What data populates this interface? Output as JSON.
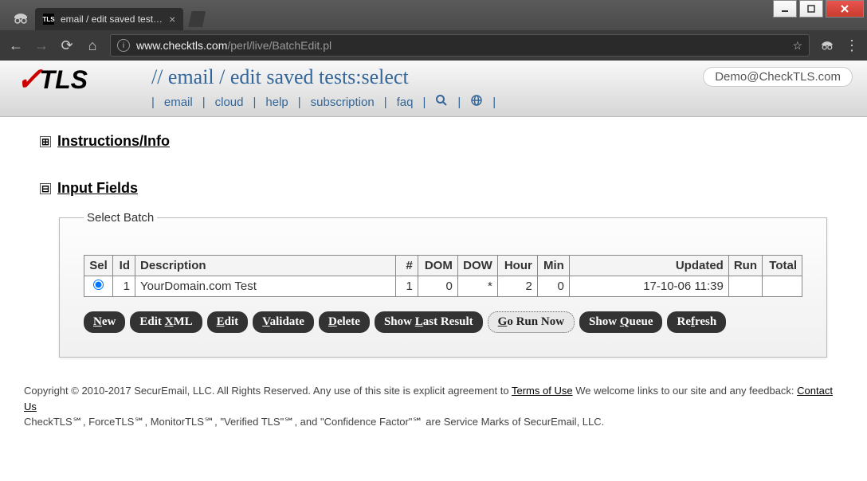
{
  "window": {
    "tab_title": "email / edit saved test…",
    "url_display": "www.checktls.com/perl/live/BatchEdit.pl",
    "url_host": "www.checktls.com",
    "url_path": "/perl/live/BatchEdit.pl"
  },
  "header": {
    "logo_text": "TLS",
    "page_title": "// email / edit saved tests:select",
    "user_email": "Demo@CheckTLS.com",
    "nav": [
      "email",
      "cloud",
      "help",
      "subscription",
      "faq"
    ]
  },
  "sections": {
    "instructions": {
      "label": "Instructions/Info",
      "expanded": false
    },
    "input_fields": {
      "label": "Input Fields",
      "expanded": true
    }
  },
  "fieldset_legend": "Select Batch",
  "table": {
    "headers": {
      "sel": "Sel",
      "id": "Id",
      "desc": "Description",
      "count": "#",
      "dom": "DOM",
      "dow": "DOW",
      "hour": "Hour",
      "min": "Min",
      "updated": "Updated",
      "run": "Run",
      "total": "Total"
    },
    "rows": [
      {
        "selected": true,
        "id": "1",
        "desc": "YourDomain.com Test",
        "count": "1",
        "dom": "0",
        "dow": "*",
        "hour": "2",
        "min": "0",
        "updated": "17-10-06 11:39",
        "run": "",
        "total": ""
      }
    ]
  },
  "buttons": {
    "new": "New",
    "edit_xml": "Edit XML",
    "edit": "Edit",
    "validate": "Validate",
    "delete": "Delete",
    "show_last": "Show Last Result",
    "go_run": "Go Run Now",
    "show_queue": "Show Queue",
    "refresh": "Refresh"
  },
  "footer": {
    "line1a": "Copyright © 2010-2017 SecurEmail, LLC. All Rights Reserved. Any use of this site is explicit agreement to ",
    "terms": "Terms of Use",
    "line1b": " We welcome links to our site and any feedback: ",
    "contact": "Contact Us",
    "line2": "CheckTLS℠, ForceTLS℠, MonitorTLS℠, \"Verified TLS\"℠, and \"Confidence Factor\"℠ are Service Marks of SecurEmail, LLC."
  }
}
